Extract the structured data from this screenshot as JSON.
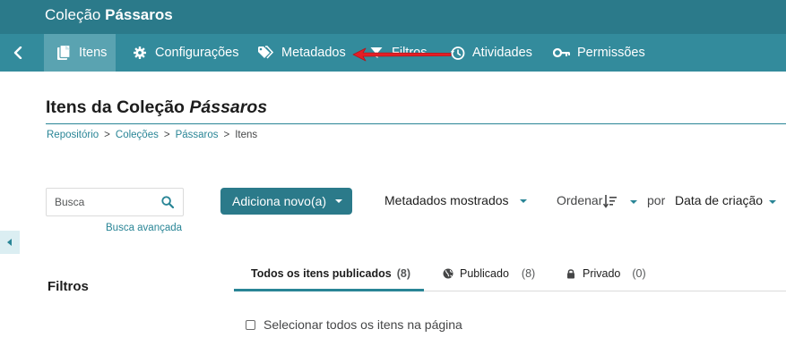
{
  "header": {
    "title_prefix": "Coleção",
    "title_name": "Pássaros"
  },
  "nav": {
    "items": [
      {
        "label": "Itens",
        "icon": "items-icon",
        "active": true
      },
      {
        "label": "Configurações",
        "icon": "gear-icon",
        "active": false
      },
      {
        "label": "Metadados",
        "icon": "tags-icon",
        "active": false
      },
      {
        "label": "Filtros",
        "icon": "filter-icon",
        "active": false
      },
      {
        "label": "Atividades",
        "icon": "activity-clock-icon",
        "active": false
      },
      {
        "label": "Permissões",
        "icon": "key-icon",
        "active": false
      }
    ],
    "annotation_arrow_color": "#e41e26"
  },
  "page": {
    "title_prefix": "Itens da Coleção",
    "title_name": "Pássaros"
  },
  "breadcrumb": {
    "items": [
      "Repositório",
      "Coleções",
      "Pássaros",
      "Itens"
    ],
    "separator": ">"
  },
  "search": {
    "placeholder": "Busca",
    "advanced_label": "Busca avançada"
  },
  "toolbar": {
    "add_new_label": "Adiciona novo(a)",
    "metadata_shown_label": "Metadados mostrados",
    "sort_label": "Ordenar",
    "by_label": "por",
    "sort_field": "Data de criação"
  },
  "filters": {
    "title": "Filtros"
  },
  "tabs": [
    {
      "label": "Todos os itens publicados",
      "count": "(8)",
      "active": true
    },
    {
      "label": "Publicado",
      "count": "(8)",
      "icon": "globe-icon",
      "active": false
    },
    {
      "label": "Privado",
      "count": "(0)",
      "icon": "lock-icon",
      "active": false
    }
  ],
  "list": {
    "select_all_label": "Selecionar todos os itens na página"
  },
  "colors": {
    "header": "#2b7a8a",
    "navbar": "#338b9c",
    "active_tab": "#5aa3b1",
    "accent": "#298596"
  }
}
